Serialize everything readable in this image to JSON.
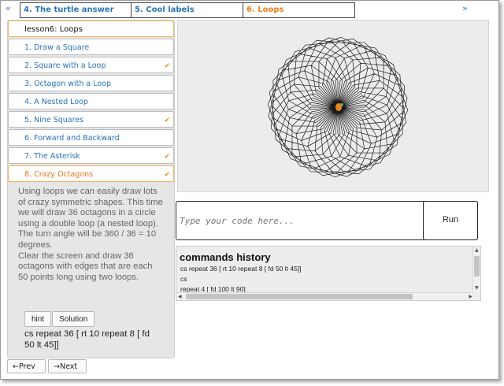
{
  "nav": {
    "prev_arrow": "«",
    "next_arrow": "»",
    "tabs": [
      {
        "label": "4. The turtle answer",
        "active": false
      },
      {
        "label": "5. Cool labels",
        "active": false
      },
      {
        "label": "6. Loops",
        "active": true
      }
    ]
  },
  "lesson": {
    "header": "lesson6: Loops",
    "items": [
      {
        "label": "1. Draw a Square",
        "done": false
      },
      {
        "label": "2. Square with a Loop",
        "done": true
      },
      {
        "label": "3. Octagon with a Loop",
        "done": false
      },
      {
        "label": "4. A Nested Loop",
        "done": false
      },
      {
        "label": "5. Nine Squares",
        "done": true
      },
      {
        "label": "6. Forward and Backward",
        "done": false
      },
      {
        "label": "7. The Asterisk",
        "done": true
      },
      {
        "label": "8. Crazy Octagons",
        "done": true
      }
    ],
    "check_glyph": "✔",
    "description": [
      "Using loops we can easily draw lots of crazy symmetric shapes. This time we will draw 36 octagons in a circle using a double loop (a nested loop). The turn angle will be 360 / 36 = 10 degrees.",
      "Clear the screen and draw 36 octagons with edges that are each 50 points long using two loops."
    ],
    "hint_label": "hint",
    "solution_label": "Solution",
    "solution_code": "cs repeat 36 [ rt 10 repeat 8 [ fd 50 lt 45]]"
  },
  "pager": {
    "prev_label": "←Prev",
    "next_label": "→Next"
  },
  "editor": {
    "placeholder": "Type your code here...",
    "run_label": "Run"
  },
  "history": {
    "title": "commands history",
    "lines": [
      "cs repeat 36 [ rt 10 repeat 8 [ fd 50 lt 45]]",
      "cs",
      "repeat 4 [ fd 100 lt 90]"
    ]
  },
  "colors": {
    "tab_link": "#2a74b8",
    "tab_active": "#f07f1a",
    "check": "#e88a25",
    "canvas_bg": "#ececec"
  }
}
